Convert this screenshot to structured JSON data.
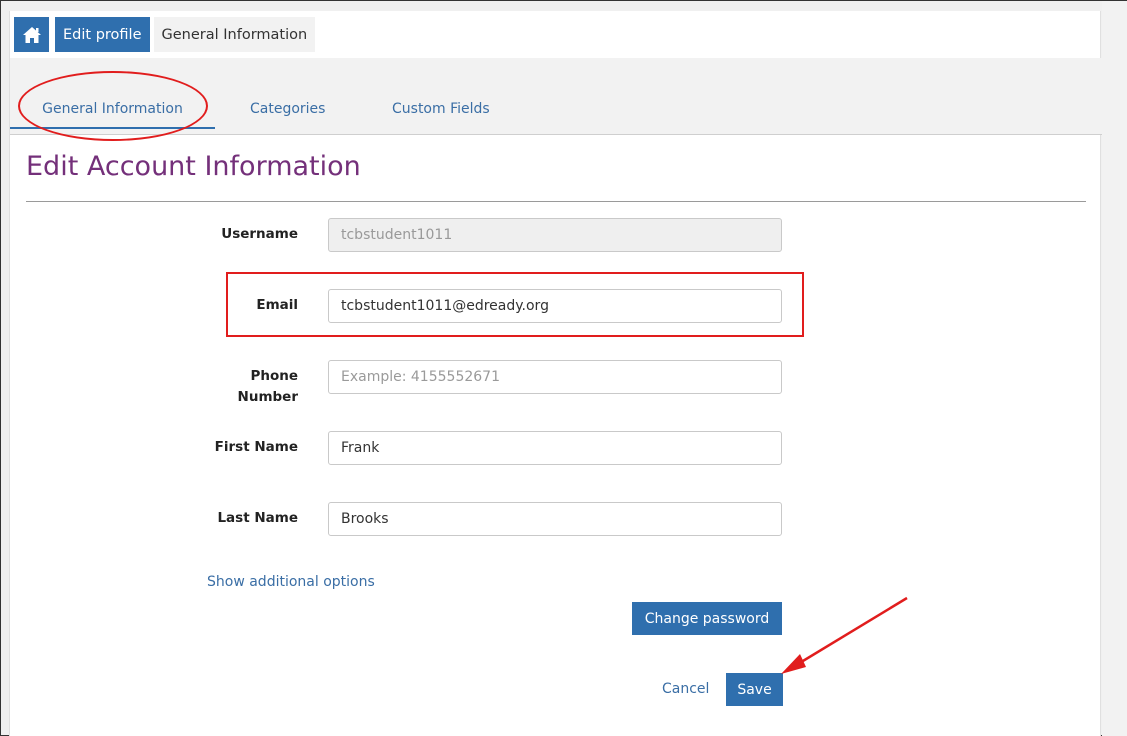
{
  "breadcrumb": {
    "home_icon": "home-icon",
    "edit_profile": "Edit profile",
    "current": "General Information"
  },
  "tabs": [
    {
      "label": "General Information",
      "active": true
    },
    {
      "label": "Categories",
      "active": false
    },
    {
      "label": "Custom Fields",
      "active": false
    }
  ],
  "heading": "Edit Account Information",
  "form": {
    "username": {
      "label": "Username",
      "value": "tcbstudent1011"
    },
    "email": {
      "label": "Email",
      "value": "tcbstudent1011@edready.org"
    },
    "phone": {
      "label_line1": "Phone",
      "label_line2": "Number",
      "placeholder": "Example: 4155552671",
      "value": ""
    },
    "first_name": {
      "label": "First Name",
      "value": "Frank"
    },
    "last_name": {
      "label": "Last Name",
      "value": "Brooks"
    }
  },
  "show_options_link": "Show additional options",
  "change_password_button": "Change password",
  "cancel_link": "Cancel",
  "save_button": "Save",
  "colors": {
    "primary": "#2f6fae",
    "heading": "#74307a",
    "annotation": "#e11d1d"
  }
}
